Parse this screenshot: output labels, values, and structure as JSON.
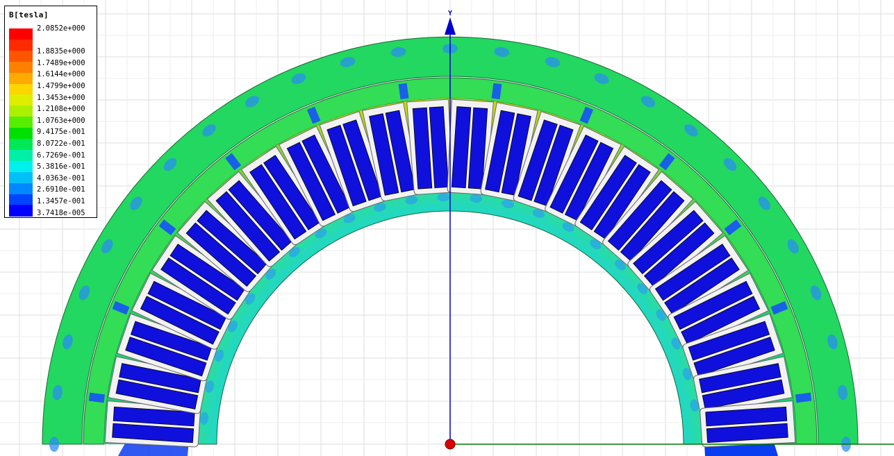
{
  "legend": {
    "title": "B[tesla]",
    "entries": [
      {
        "label": "2.0852e+000",
        "color": "#ff0000"
      },
      {
        "label": "",
        "color": "#ff2a00"
      },
      {
        "label": "1.8835e+000",
        "color": "#ff5500"
      },
      {
        "label": "1.7489e+000",
        "color": "#ff8000"
      },
      {
        "label": "1.6144e+000",
        "color": "#ffaa00"
      },
      {
        "label": "1.4799e+000",
        "color": "#ffd500"
      },
      {
        "label": "1.3453e+000",
        "color": "#dfee00"
      },
      {
        "label": "1.2108e+000",
        "color": "#aaf000"
      },
      {
        "label": "1.0763e+000",
        "color": "#55ee00"
      },
      {
        "label": "9.4175e-001",
        "color": "#00e000"
      },
      {
        "label": "8.0722e-001",
        "color": "#00e855"
      },
      {
        "label": "6.7269e-001",
        "color": "#00f0aa"
      },
      {
        "label": "5.3816e-001",
        "color": "#00f0f0"
      },
      {
        "label": "4.0363e-001",
        "color": "#00c0f8"
      },
      {
        "label": "2.6910e-001",
        "color": "#0088ff"
      },
      {
        "label": "1.3457e-001",
        "color": "#0044ff"
      },
      {
        "label": "3.7418e-005",
        "color": "#0000ff"
      }
    ]
  },
  "axes": {
    "y_label": "Y",
    "y_axis_color": "#0000cc",
    "x_axis_color": "#007700",
    "origin_marker_color": "#dd0000"
  },
  "colors": {
    "outer_yoke": "#22d860",
    "stator_yoke": "#33dd55",
    "tooth_high": "#dddd00",
    "tooth_low": "#22cc77",
    "slot_fill": "#f2f2f2",
    "coil": "#1010dd",
    "inner_ring": "#22d8a0",
    "low_field": "#0a3cf0",
    "grid": "#dcdcdc"
  },
  "model": {
    "slot_count": 24
  }
}
